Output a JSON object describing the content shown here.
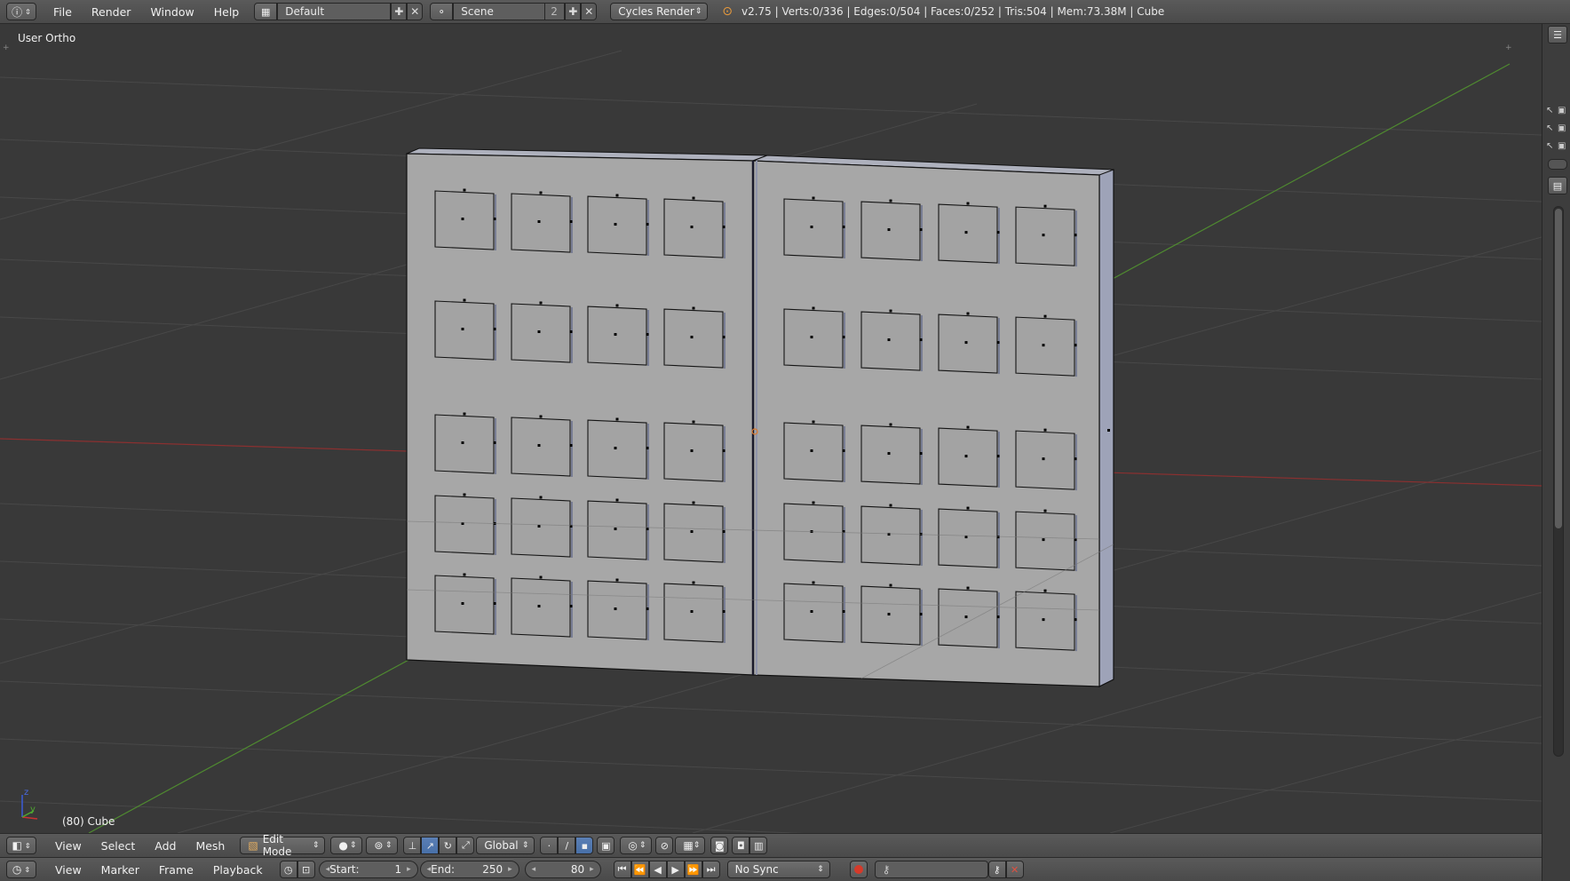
{
  "top_header": {
    "editor_icon": "info-icon",
    "menus": [
      "File",
      "Render",
      "Window",
      "Help"
    ],
    "screen_layout": "Default",
    "scene": "Scene",
    "scene_users": "2",
    "render_engine": "Cycles Render",
    "stats": "v2.75 | Verts:0/336 | Edges:0/504 | Faces:0/252 | Tris:504 | Mem:73.38M | Cube"
  },
  "viewport": {
    "view_name": "User Ortho",
    "object_info": "(80) Cube",
    "axis_labels": {
      "z": "z",
      "y": "y"
    },
    "colors": {
      "background": "#393939",
      "grid": "#4a4a4a",
      "x_axis": "#8a3030",
      "y_axis": "#4f8a30",
      "mesh_face": "#a6a6a6",
      "mesh_side": "#9da2b5",
      "edge": "#111111"
    }
  },
  "view3d_header": {
    "editor_icon": "view3d-icon",
    "menus": [
      "View",
      "Select",
      "Add",
      "Mesh"
    ],
    "mode": "Edit Mode",
    "orientation": "Global"
  },
  "timeline_header": {
    "editor_icon": "clock-icon",
    "menus": [
      "View",
      "Marker",
      "Frame",
      "Playback"
    ],
    "start_label": "Start:",
    "start_value": "1",
    "end_label": "End:",
    "end_value": "250",
    "current_frame": "80",
    "sync": "No Sync"
  }
}
